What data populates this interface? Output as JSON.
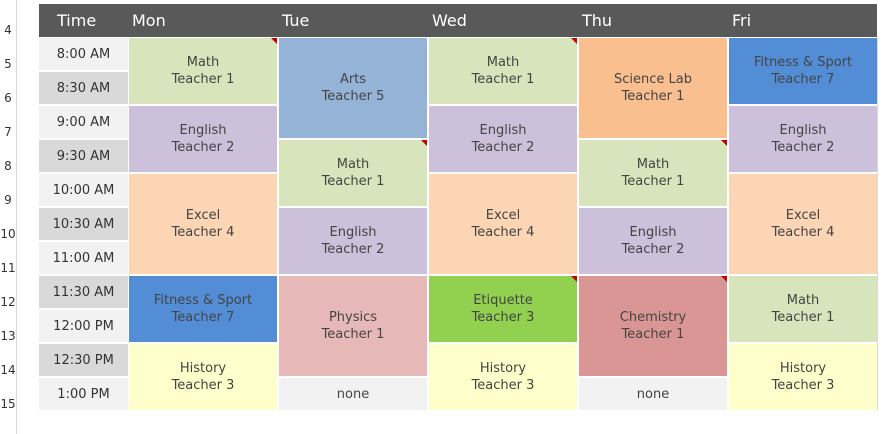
{
  "row_numbers": [
    "4",
    "5",
    "6",
    "7",
    "8",
    "9",
    "10",
    "11",
    "12",
    "13",
    "14",
    "15"
  ],
  "header": {
    "time": "Time",
    "days": [
      "Mon",
      "Tue",
      "Wed",
      "Thu",
      "Fri"
    ]
  },
  "times": [
    "8:00 AM",
    "8:30 AM",
    "9:00 AM",
    "9:30 AM",
    "10:00 AM",
    "10:30 AM",
    "11:00 AM",
    "11:30 AM",
    "12:00 PM",
    "12:30 PM",
    "1:00 PM"
  ],
  "colors": {
    "math": "#d8e4bc",
    "english": "#ccc0da",
    "excel": "#fcd5b4",
    "fitness": "#538dd5",
    "history": "#ffffcc",
    "arts": "#95b3d7",
    "physics": "#e6b8b7",
    "none": "#f2f2f2",
    "etiquette": "#92d050",
    "science": "#fabf8f",
    "chemistry": "#da9694"
  },
  "schedule": {
    "mon": [
      {
        "subject": "Math",
        "teacher": "Teacher 1",
        "flag": true
      },
      {
        "subject": "English",
        "teacher": "Teacher 2"
      },
      {
        "subject": "Excel",
        "teacher": "Teacher 4"
      },
      {
        "subject": "Fitness & Sport",
        "teacher": "Teacher 7"
      },
      {
        "subject": "History",
        "teacher": "Teacher 3"
      }
    ],
    "tue": [
      {
        "subject": "Arts",
        "teacher": "Teacher 5"
      },
      {
        "subject": "Math",
        "teacher": "Teacher 1",
        "flag": true
      },
      {
        "subject": "English",
        "teacher": "Teacher 2"
      },
      {
        "subject": "Physics",
        "teacher": "Teacher 1"
      },
      {
        "subject": "none"
      }
    ],
    "wed": [
      {
        "subject": "Math",
        "teacher": "Teacher 1",
        "flag": true
      },
      {
        "subject": "English",
        "teacher": "Teacher 2"
      },
      {
        "subject": "Excel",
        "teacher": "Teacher 4"
      },
      {
        "subject": "Etiquette",
        "teacher": "Teacher 3",
        "flag": true
      },
      {
        "subject": "History",
        "teacher": "Teacher 3"
      }
    ],
    "thu": [
      {
        "subject": "Science Lab",
        "teacher": "Teacher 1"
      },
      {
        "subject": "Math",
        "teacher": "Teacher 1",
        "flag": true
      },
      {
        "subject": "English",
        "teacher": "Teacher 2"
      },
      {
        "subject": "Chemistry",
        "teacher": "Teacher 1"
      },
      {
        "subject": "none"
      }
    ],
    "fri": [
      {
        "subject": "Fitness & Sport",
        "teacher": "Teacher 7"
      },
      {
        "subject": "English",
        "teacher": "Teacher 2"
      },
      {
        "subject": "Excel",
        "teacher": "Teacher 4"
      },
      {
        "subject": "Math",
        "teacher": "Teacher 1"
      },
      {
        "subject": "History",
        "teacher": "Teacher 3"
      }
    ]
  }
}
